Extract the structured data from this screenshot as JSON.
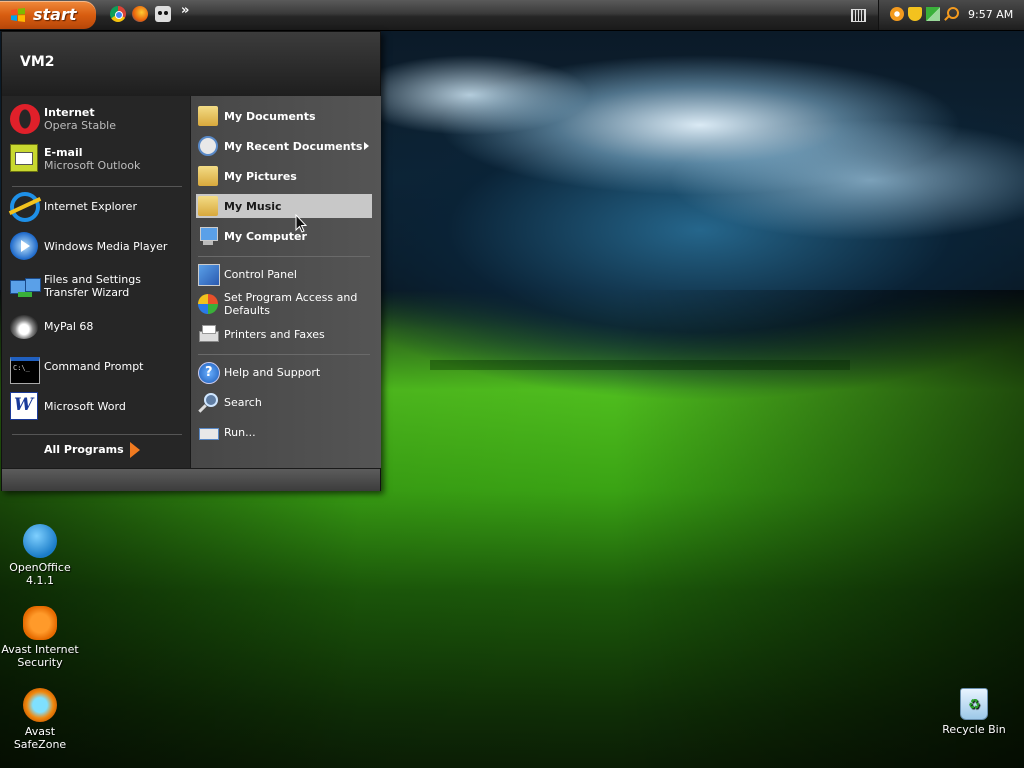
{
  "taskbar": {
    "start_label": "start",
    "clock": "9:57 AM",
    "overflow_glyph": "»",
    "quick_launch": [
      "chrome-icon",
      "firefox-icon",
      "eye-icon"
    ],
    "tray_icons": [
      "avast-icon",
      "shield-icon",
      "network-icon",
      "search-icon"
    ]
  },
  "start_menu": {
    "user": "VM2",
    "pinned": [
      {
        "title": "Internet",
        "subtitle": "Opera Stable",
        "icon": "opera-icon"
      },
      {
        "title": "E-mail",
        "subtitle": "Microsoft Outlook",
        "icon": "outlook-icon"
      }
    ],
    "recent": [
      {
        "label": "Internet Explorer",
        "icon": "ie-icon"
      },
      {
        "label": "Windows Media Player",
        "icon": "media-player-icon"
      },
      {
        "label": "Files and Settings Transfer Wizard",
        "icon": "transfer-wizard-icon"
      },
      {
        "label": "MyPal 68",
        "icon": "mypal-icon"
      },
      {
        "label": "Command Prompt",
        "icon": "cmd-icon"
      },
      {
        "label": "Microsoft Word",
        "icon": "word-icon"
      }
    ],
    "all_programs": "All Programs",
    "places": [
      {
        "label": "My Documents",
        "icon": "folder-icon"
      },
      {
        "label": "My Recent Documents",
        "icon": "recent-docs-icon"
      },
      {
        "label": "My Pictures",
        "icon": "folder-icon"
      },
      {
        "label": "My Music",
        "icon": "folder-icon"
      },
      {
        "label": "My Computer",
        "icon": "computer-icon"
      }
    ],
    "settings": [
      {
        "label": "Control Panel",
        "icon": "control-panel-icon"
      },
      {
        "label": "Set Program Access and Defaults",
        "icon": "program-access-icon"
      },
      {
        "label": "Printers and Faxes",
        "icon": "printer-icon"
      }
    ],
    "system": [
      {
        "label": "Help and Support",
        "icon": "help-icon"
      },
      {
        "label": "Search",
        "icon": "search-icon"
      },
      {
        "label": "Run...",
        "icon": "run-icon"
      }
    ]
  },
  "desktop_icons": [
    {
      "label": "OpenOffice 4.1.1",
      "icon": "openoffice-icon"
    },
    {
      "label": "Avast Internet Security",
      "icon": "avast-icon"
    },
    {
      "label": "Avast SafeZone",
      "icon": "safezone-icon"
    },
    {
      "label": "Recycle Bin",
      "icon": "recycle-bin-icon"
    }
  ]
}
